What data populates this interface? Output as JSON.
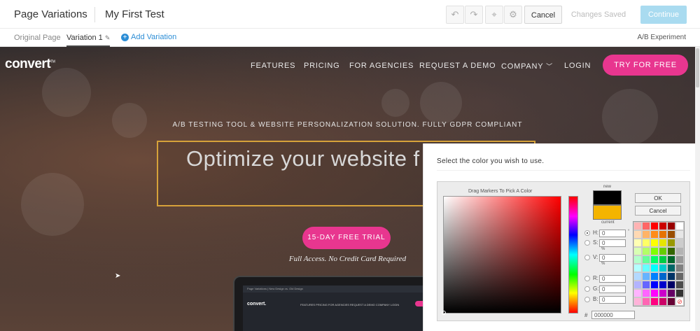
{
  "topbar": {
    "title": "Page Variations",
    "test_name": "My First Test",
    "icons": [
      "undo-icon",
      "redo-icon",
      "code-icon",
      "gear-icon"
    ],
    "cancel_label": "Cancel",
    "saved_label": "Changes Saved",
    "continue_label": "Continue"
  },
  "subbar": {
    "original_label": "Original Page",
    "variation_label": "Variation 1",
    "add_variation_label": "Add Variation",
    "experiment_type": "A/B Experiment"
  },
  "site": {
    "logo": "conv",
    "logo_rest": "ert",
    "logo_tm": "TM",
    "nav": [
      "FEATURES",
      "PRICING",
      "FOR AGENCIES",
      "REQUEST A DEMO",
      "COMPANY",
      "LOGIN"
    ],
    "try_label": "TRY FOR FREE",
    "tagline": "A/B TESTING TOOL & WEBSITE PERSONALIZATION SOLUTION. FULLY GDPR COMPLIANT",
    "headline": "Optimize your website f",
    "trial_label": "15-DAY FREE TRIAL",
    "full_access": "Full Access. No Credit Card Required",
    "laptop": {
      "bar_text": "Page Variations  |  New Design vs. Old Design",
      "logo": "convert.",
      "nav": "FEATURES  PRICING  FOR AGENCIES  REQUEST A DEMO  COMPANY  LOGIN"
    },
    "colors": {
      "accent_pink": "#e8368f",
      "headline_border": "#d6a23a"
    }
  },
  "color_picker": {
    "title": "Select the color you wish to use.",
    "drag_text": "Drag Markers To Pick A Color",
    "new_label": "new",
    "current_label": "current",
    "new_color": "#000000",
    "current_color": "#f4b400",
    "ok_label": "OK",
    "cancel_label": "Cancel",
    "fields": [
      {
        "label": "H:",
        "value": "0",
        "unit": "°",
        "selected": true
      },
      {
        "label": "S:",
        "value": "0",
        "unit": "%",
        "selected": false
      },
      {
        "label": "V:",
        "value": "0",
        "unit": "%",
        "selected": false
      },
      {
        "label": "R:",
        "value": "0",
        "unit": "",
        "selected": false
      },
      {
        "label": "G:",
        "value": "0",
        "unit": "",
        "selected": false
      },
      {
        "label": "B:",
        "value": "0",
        "unit": "",
        "selected": false
      }
    ],
    "hex_label": "#",
    "hex_value": "000000",
    "palette": [
      "#ffb3b3",
      "#ff6666",
      "#ff0000",
      "#cc0000",
      "#990000",
      "#ffffff",
      "#ffd9b3",
      "#ffb366",
      "#ff8c1a",
      "#e67300",
      "#994d00",
      "#e6e6e6",
      "#ffffb3",
      "#ffff66",
      "#ffff00",
      "#e6e600",
      "#999900",
      "#cccccc",
      "#d9ffb3",
      "#b3ff66",
      "#80ff00",
      "#66cc00",
      "#336600",
      "#b3b3b3",
      "#b3ffcc",
      "#66ff99",
      "#00ff66",
      "#00cc44",
      "#00662b",
      "#999999",
      "#b3ffff",
      "#66ffff",
      "#00ffff",
      "#00cccc",
      "#006666",
      "#808080",
      "#b3d9ff",
      "#66b3ff",
      "#0080ff",
      "#0066cc",
      "#003366",
      "#666666",
      "#b3b3ff",
      "#6666ff",
      "#0000ff",
      "#0000cc",
      "#000066",
      "#4d4d4d",
      "#ffb3ff",
      "#ff66ff",
      "#ff00ff",
      "#cc00cc",
      "#660066",
      "#333333",
      "#ffb3d9",
      "#ff66b3",
      "#ff0080",
      "#cc0066",
      "#660033",
      "#transparent"
    ]
  }
}
